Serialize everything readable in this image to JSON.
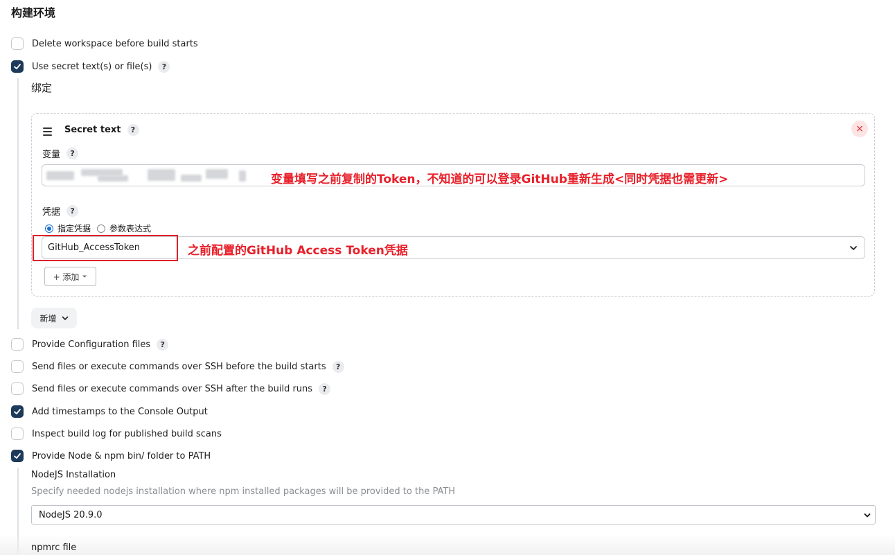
{
  "section_title": "构建环境",
  "checkboxes": [
    {
      "label": "Delete workspace before build starts",
      "checked": false,
      "help": false
    },
    {
      "label": "Use secret text(s) or file(s)",
      "checked": true,
      "help": true
    },
    {
      "label": "Provide Configuration files",
      "checked": false,
      "help": true
    },
    {
      "label": "Send files or execute commands over SSH before the build starts",
      "checked": false,
      "help": true
    },
    {
      "label": "Send files or execute commands over SSH after the build runs",
      "checked": false,
      "help": true
    },
    {
      "label": "Add timestamps to the Console Output",
      "checked": true,
      "help": false
    },
    {
      "label": "Inspect build log for published build scans",
      "checked": false,
      "help": false
    },
    {
      "label": "Provide Node & npm bin/ folder to PATH",
      "checked": true,
      "help": false
    }
  ],
  "help_glyph": "?",
  "bindings": {
    "heading": "绑定",
    "card": {
      "title": "Secret text",
      "close_glyph": "×",
      "variable_label": "变量",
      "variable_annotation": "变量填写之前复制的Token，不知道的可以登录GitHub重新生成<同时凭据也需更新>",
      "credentials_label": "凭据",
      "radio_specific": "指定凭据",
      "radio_expression": "参数表达式",
      "credential_value": "GitHub_AccessToken",
      "credential_annotation": "之前配置的GitHub Access Token凭据",
      "add_button": "+ 添加"
    },
    "new_button": "新增"
  },
  "nodejs": {
    "label": "NodeJS Installation",
    "description": "Specify needed nodejs installation where npm installed packages will be provided to the PATH",
    "selected": "NodeJS 20.9.0",
    "npmrc_label": "npmrc file"
  },
  "colors": {
    "checked": "#1c3a5a",
    "annotation": "#e8202a"
  }
}
